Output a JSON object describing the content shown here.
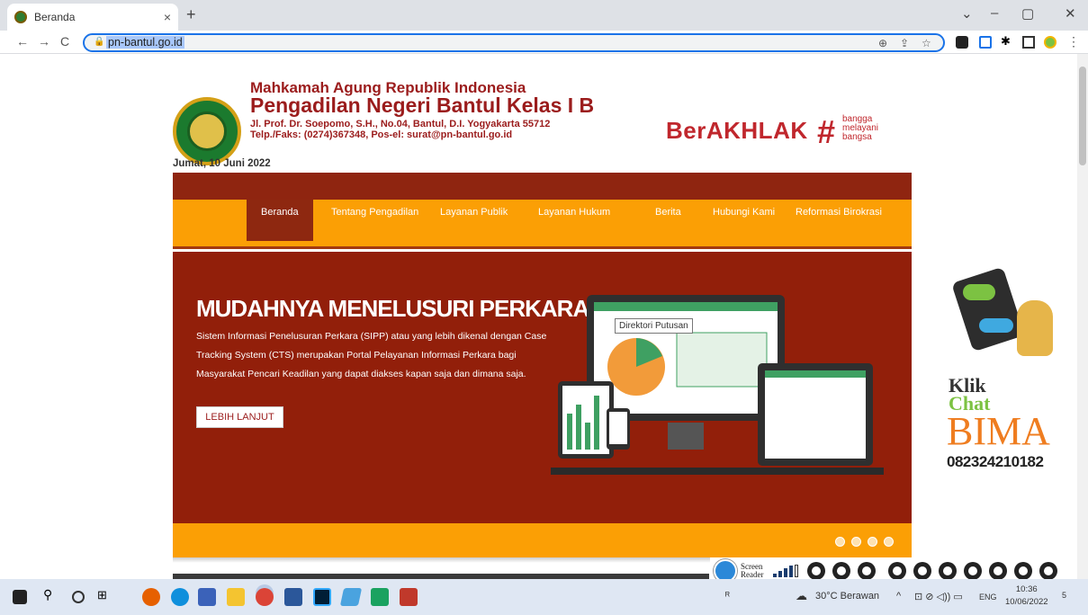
{
  "browser": {
    "tab_title": "Beranda",
    "tab_close": "×",
    "new_tab": "+",
    "url": "pn-bantul.go.id",
    "back": "←",
    "forward": "→",
    "reload": "C",
    "minimize": "–",
    "maximize": "▢",
    "close": "✕",
    "dropdown": "⌄",
    "menu": "⋮"
  },
  "header": {
    "line1": "Mahkamah Agung Republik Indonesia",
    "line2": "Pengadilan Negeri Bantul Kelas I B",
    "line3": "Jl. Prof. Dr. Soepomo, S.H., No.04, Bantul, D.I. Yogyakarta 55712",
    "line4": "Telp./Faks: (0274)367348, Pos-el: surat@pn-bantul.go.id",
    "brand": "BerAKHLAK",
    "hash": "#",
    "tag1": "bangga",
    "tag2": "melayani",
    "tag3": "bangsa",
    "date": "Jumat, 10 Juni 2022"
  },
  "nav": {
    "items": [
      "Beranda",
      "Tentang Pengadilan",
      "Layanan Publik",
      "Layanan Hukum",
      "Berita",
      "Hubungi Kami",
      "Reformasi Birokrasi"
    ]
  },
  "hero": {
    "title": "MUDAHNYA MENELUSURI PERKARA",
    "description": "Sistem Informasi Penelusuran Perkara (SIPP) atau yang lebih dikenal dengan Case Tracking System (CTS) merupakan Portal Pelayanan Informasi Perkara bagi Masyarakat Pencari Keadilan yang dapat diakses kapan saja dan dimana saja.",
    "button": "LEBIH LANJUT",
    "tooltip": "Direktori Putusan"
  },
  "bima": {
    "klik": "Klik",
    "chat": "Chat",
    "name": "BIMA",
    "phone": "082324210182"
  },
  "screen_reader": {
    "line1": "Screen",
    "line2": "Reader"
  },
  "taskbar": {
    "weather": "30°C Berawan",
    "lang": "ENG",
    "time": "10:36",
    "date": "10/06/2022",
    "notif": "5"
  },
  "colors": {
    "maroon": "#921f0a",
    "orange": "#fb9f05",
    "brand_red": "#c0272d"
  }
}
